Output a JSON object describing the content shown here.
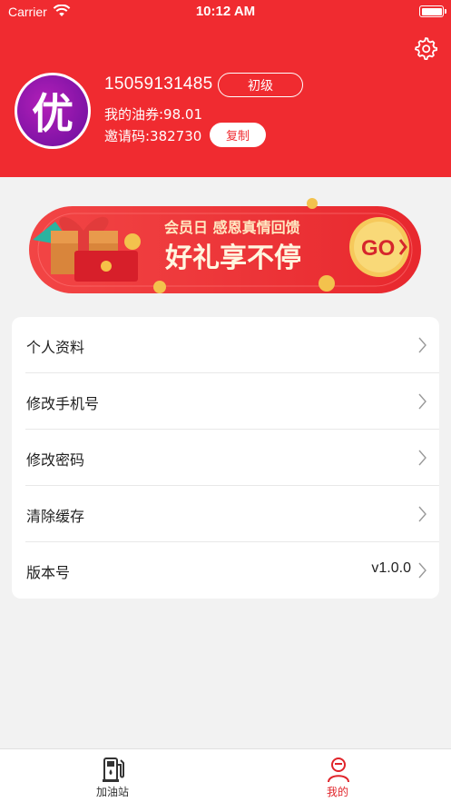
{
  "status_bar": {
    "carrier": "Carrier",
    "time": "10:12 AM"
  },
  "profile": {
    "phone": "15059131485",
    "level": "初级",
    "coupon": "我的油券:98.01",
    "invite_code": "邀请码:382730",
    "copy_label": "复制",
    "avatar_glyph": "优"
  },
  "banner": {
    "subtitle": "会员日 感恩真情回馈",
    "title": "好礼享不停",
    "go_label": "GO"
  },
  "menu": {
    "items": [
      {
        "label": "个人资料",
        "value": ""
      },
      {
        "label": "修改手机号",
        "value": ""
      },
      {
        "label": "修改密码",
        "value": ""
      },
      {
        "label": "清除缓存",
        "value": ""
      },
      {
        "label": "版本号",
        "value": "v1.0.0"
      }
    ]
  },
  "tabbar": {
    "tabs": [
      {
        "label": "加油站",
        "active": false
      },
      {
        "label": "我的",
        "active": true
      }
    ],
    "active_color": "#e0242a",
    "inactive_color": "#333333"
  },
  "colors": {
    "brand_red": "#f02b30",
    "background": "#f2f2f2"
  }
}
